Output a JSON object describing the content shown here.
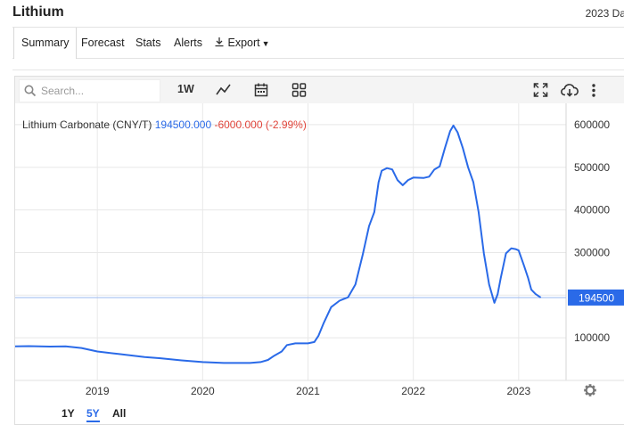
{
  "header": {
    "title": "Lithium",
    "date_text": "2023 Da"
  },
  "tabs": [
    {
      "label": "Summary",
      "active": true
    },
    {
      "label": "Forecast",
      "active": false
    },
    {
      "label": "Stats",
      "active": false
    },
    {
      "label": "Alerts",
      "active": false
    },
    {
      "label": "Export",
      "active": false
    }
  ],
  "toolbar": {
    "search_placeholder": "Search...",
    "interval_label": "1W",
    "icons": [
      "search-icon",
      "line-chart-icon",
      "calendar-icon",
      "grid-icon",
      "fullscreen-icon",
      "cloud-download-icon",
      "more-vert-icon",
      "download-icon",
      "settings-gear-icon"
    ]
  },
  "periods": [
    {
      "label": "1Y",
      "active": false
    },
    {
      "label": "5Y",
      "active": true
    },
    {
      "label": "All",
      "active": false
    }
  ],
  "colors": {
    "line": "#2a6ae8",
    "price_label_bg": "#2a6ae8",
    "negative_change": "#e0443a",
    "grid": "#e8e8e8"
  },
  "chart_data": {
    "type": "line",
    "legend": {
      "name": "Lithium Carbonate (CNY/T)",
      "last_value": "194500.000",
      "change": "-6000.000 (-2.99%)"
    },
    "current_price_label": "194500",
    "current_price": 194500,
    "x_ticks": [
      "2019",
      "2020",
      "2021",
      "2022",
      "2023"
    ],
    "y_ticks": [
      "100000",
      "200000",
      "300000",
      "400000",
      "500000",
      "600000"
    ],
    "y_tick_values": [
      100000,
      200000,
      300000,
      400000,
      500000,
      600000
    ],
    "ylim": [
      0,
      650000
    ],
    "xlim": [
      2018.22,
      2023.45
    ],
    "grid": true,
    "series": [
      {
        "name": "Lithium Carbonate (CNY/T)",
        "points": [
          [
            2018.22,
            80000
          ],
          [
            2018.35,
            80500
          ],
          [
            2018.55,
            79500
          ],
          [
            2018.7,
            80000
          ],
          [
            2018.85,
            76000
          ],
          [
            2019.0,
            68000
          ],
          [
            2019.2,
            62000
          ],
          [
            2019.45,
            55000
          ],
          [
            2019.6,
            52000
          ],
          [
            2019.8,
            47000
          ],
          [
            2020.0,
            43000
          ],
          [
            2020.2,
            41000
          ],
          [
            2020.45,
            41000
          ],
          [
            2020.55,
            43000
          ],
          [
            2020.62,
            48000
          ],
          [
            2020.68,
            58000
          ],
          [
            2020.75,
            68000
          ],
          [
            2020.8,
            83000
          ],
          [
            2020.88,
            87000
          ],
          [
            2021.0,
            87000
          ],
          [
            2021.06,
            90000
          ],
          [
            2021.1,
            105000
          ],
          [
            2021.15,
            135000
          ],
          [
            2021.22,
            172000
          ],
          [
            2021.3,
            187000
          ],
          [
            2021.38,
            195000
          ],
          [
            2021.45,
            225000
          ],
          [
            2021.52,
            295000
          ],
          [
            2021.58,
            362000
          ],
          [
            2021.63,
            395000
          ],
          [
            2021.67,
            465000
          ],
          [
            2021.7,
            492000
          ],
          [
            2021.75,
            498000
          ],
          [
            2021.8,
            495000
          ],
          [
            2021.85,
            470000
          ],
          [
            2021.9,
            458000
          ],
          [
            2021.95,
            470000
          ],
          [
            2022.0,
            476000
          ],
          [
            2022.1,
            475000
          ],
          [
            2022.15,
            478000
          ],
          [
            2022.2,
            495000
          ],
          [
            2022.25,
            502000
          ],
          [
            2022.3,
            545000
          ],
          [
            2022.35,
            585000
          ],
          [
            2022.38,
            598000
          ],
          [
            2022.42,
            582000
          ],
          [
            2022.47,
            545000
          ],
          [
            2022.52,
            500000
          ],
          [
            2022.57,
            465000
          ],
          [
            2022.62,
            395000
          ],
          [
            2022.67,
            298000
          ],
          [
            2022.72,
            225000
          ],
          [
            2022.77,
            182000
          ],
          [
            2022.8,
            202000
          ],
          [
            2022.83,
            240000
          ],
          [
            2022.88,
            298000
          ],
          [
            2022.93,
            310000
          ],
          [
            2022.97,
            308000
          ],
          [
            2023.0,
            305000
          ],
          [
            2023.05,
            270000
          ],
          [
            2023.09,
            240000
          ],
          [
            2023.12,
            213000
          ],
          [
            2023.16,
            203000
          ],
          [
            2023.21,
            194500
          ]
        ]
      }
    ]
  }
}
